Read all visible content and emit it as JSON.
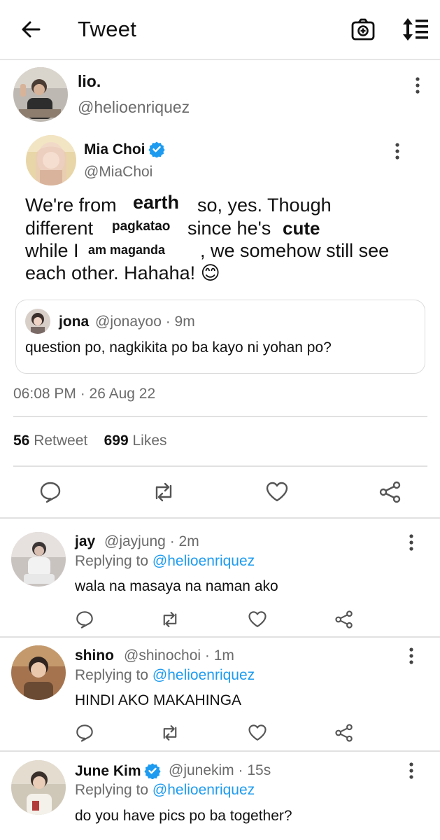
{
  "header": {
    "title": "Tweet"
  },
  "tweet": {
    "author_name": "lio.",
    "author_handle": "@helioenriquez",
    "quoted": {
      "name": "Mia Choi",
      "handle": "@MiaChoi",
      "line1_a": "We're from",
      "line1_sticker": "earth",
      "line1_b": "so, yes. Though",
      "line2_a": "different",
      "line2_sticker1": "pagkatao",
      "line2_b": "since he's",
      "line2_sticker2": "cute",
      "line3_a": "while I",
      "line3_sticker": "am maganda",
      "line3_b": ", we somehow still see",
      "line4": "each other. Hahaha! 😊",
      "inner_quote": {
        "name": "jona",
        "meta": "@jonayoo · 9m",
        "text": "question po, nagkikita po ba kayo ni yohan po?"
      }
    },
    "timestamp": "06:08 PM · 26 Aug 22",
    "retweets_count": "56",
    "retweets_label": "Retweet",
    "likes_count": "699",
    "likes_label": "Likes"
  },
  "replies": [
    {
      "name": "jay",
      "meta": "@jayjung · 2m",
      "replying_prefix": "Replying to",
      "replying_to": "@helioenriquez",
      "text": "wala na masaya na naman ako"
    },
    {
      "name": "shino",
      "meta": "@shinochoi · 1m",
      "replying_prefix": "Replying to",
      "replying_to": "@helioenriquez",
      "text": "HINDI AKO MAKAHINGA"
    },
    {
      "name": "June Kim",
      "meta": "@junekim · 15s",
      "replying_prefix": "Replying to",
      "replying_to": "@helioenriquez",
      "text": "do you have pics po ba together?"
    }
  ],
  "icons": {
    "back": "back-arrow-icon",
    "camera": "camera-add-icon",
    "sort": "sort-icon",
    "more": "more-vertical-icon",
    "verified": "verified-badge-icon",
    "reply": "reply-icon",
    "retweet": "retweet-icon",
    "like": "like-icon",
    "share": "share-icon"
  },
  "colors": {
    "accent": "#1d9bf0",
    "text": "#111111",
    "muted": "#6b6b6b",
    "divider": "#e1e1e1"
  }
}
